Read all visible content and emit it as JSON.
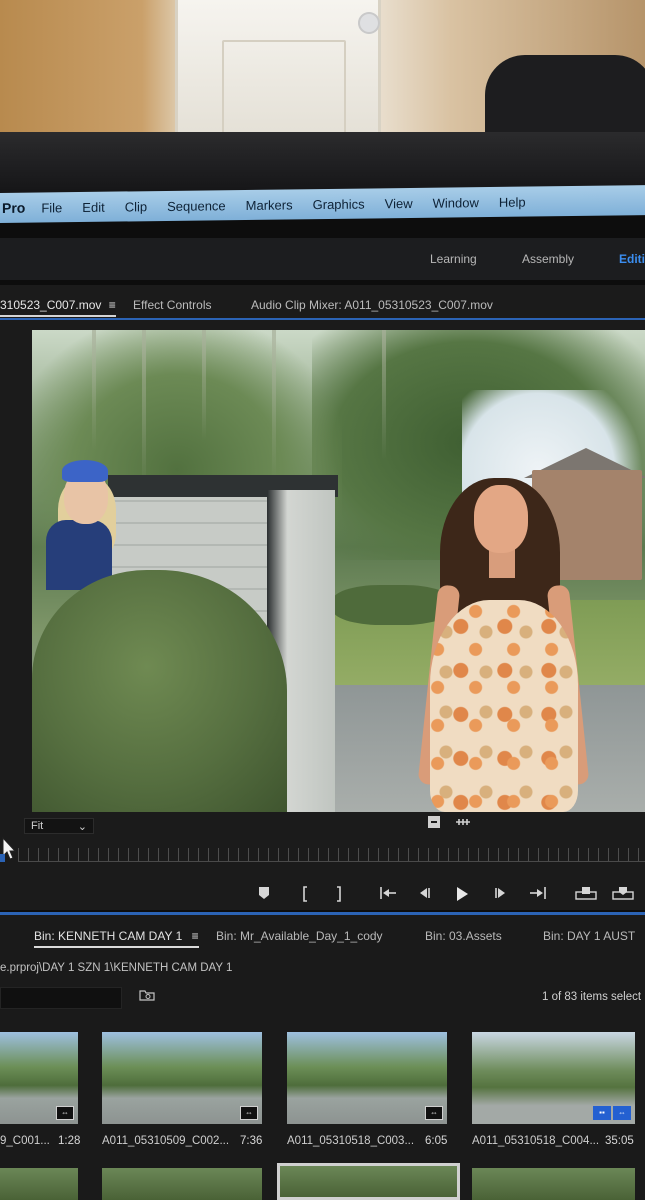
{
  "menubar": {
    "app_name": "Pro",
    "items": [
      "File",
      "Edit",
      "Clip",
      "Sequence",
      "Markers",
      "Graphics",
      "View",
      "Window",
      "Help"
    ]
  },
  "workspaces": [
    "Learning",
    "Assembly",
    "Editi"
  ],
  "monitor_tabs": {
    "source": "310523_C007.mov",
    "menu_glyph": "≡",
    "effect_controls": "Effect Controls",
    "audio_clip_mixer": "Audio Clip Mixer: A011_05310523_C007.mov"
  },
  "fit_dropdown": {
    "value": "Fit",
    "chevron": "⌄"
  },
  "project": {
    "bins": [
      {
        "label": "Bin: KENNETH CAM DAY 1",
        "menu": "≡"
      },
      {
        "label": "Bin: Mr_Available_Day_1_cody"
      },
      {
        "label": "Bin: 03.Assets"
      },
      {
        "label": "Bin: DAY 1 AUST"
      }
    ],
    "path": "e.prproj\\DAY 1 SZN 1\\KENNETH CAM DAY 1",
    "item_count": "1 of 83 items select",
    "clips": [
      {
        "name": "9_C001...",
        "duration": "1:28"
      },
      {
        "name": "A011_05310509_C002...",
        "duration": "7:36"
      },
      {
        "name": "A011_05310518_C003...",
        "duration": "6:05"
      },
      {
        "name": "A011_05310518_C004...",
        "duration": "35:05"
      }
    ]
  },
  "colors": {
    "accent": "#2b63b5",
    "active_workspace": "#3b8ef0",
    "menubar": "#9cc4e4"
  }
}
